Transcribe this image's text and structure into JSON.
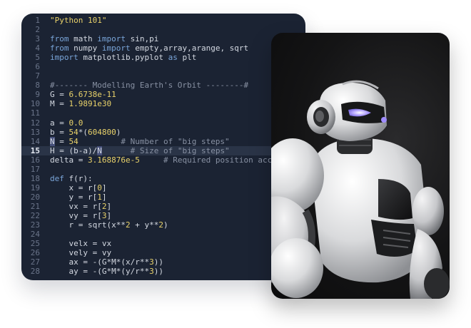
{
  "editor": {
    "active_line": 15,
    "lines": [
      {
        "n": "1",
        "t": [
          {
            "c": "str",
            "s": "\"Python 101\""
          }
        ]
      },
      {
        "n": "2",
        "t": []
      },
      {
        "n": "3",
        "t": [
          {
            "c": "kw",
            "s": "from"
          },
          {
            "c": "",
            "s": " math "
          },
          {
            "c": "kw",
            "s": "import"
          },
          {
            "c": "",
            "s": " sin,pi"
          }
        ]
      },
      {
        "n": "4",
        "t": [
          {
            "c": "kw",
            "s": "from"
          },
          {
            "c": "",
            "s": " numpy "
          },
          {
            "c": "kw",
            "s": "import"
          },
          {
            "c": "",
            "s": " empty,array,arange, sqrt"
          }
        ]
      },
      {
        "n": "5",
        "t": [
          {
            "c": "kw",
            "s": "import"
          },
          {
            "c": "",
            "s": " matplotlib.pyplot "
          },
          {
            "c": "kw",
            "s": "as"
          },
          {
            "c": "",
            "s": " plt"
          }
        ]
      },
      {
        "n": "6",
        "t": []
      },
      {
        "n": "7",
        "t": []
      },
      {
        "n": "8",
        "t": [
          {
            "c": "cmt",
            "s": "#------- Modelling Earth's Orbit --------#"
          }
        ]
      },
      {
        "n": "9",
        "t": [
          {
            "c": "",
            "s": "G = "
          },
          {
            "c": "num",
            "s": "6.6738e-11"
          }
        ]
      },
      {
        "n": "10",
        "t": [
          {
            "c": "",
            "s": "M = "
          },
          {
            "c": "num",
            "s": "1.9891e30"
          }
        ]
      },
      {
        "n": "11",
        "t": []
      },
      {
        "n": "12",
        "t": [
          {
            "c": "",
            "s": "a = "
          },
          {
            "c": "num",
            "s": "0.0"
          }
        ]
      },
      {
        "n": "13",
        "t": [
          {
            "c": "",
            "s": "b = "
          },
          {
            "c": "num",
            "s": "54"
          },
          {
            "c": "",
            "s": "*("
          },
          {
            "c": "num",
            "s": "604800"
          },
          {
            "c": "",
            "s": ")"
          }
        ]
      },
      {
        "n": "14",
        "t": [
          {
            "c": "sel",
            "s": "N"
          },
          {
            "c": "",
            "s": " = "
          },
          {
            "c": "num",
            "s": "54"
          },
          {
            "c": "",
            "s": "         "
          },
          {
            "c": "cmt",
            "s": "# Number of \"big steps\""
          }
        ]
      },
      {
        "n": "15",
        "t": [
          {
            "c": "",
            "s": "H = (b-a)/"
          },
          {
            "c": "sel",
            "s": "N"
          },
          {
            "c": "",
            "s": "      "
          },
          {
            "c": "cmt",
            "s": "# Size of \"big steps\""
          }
        ]
      },
      {
        "n": "16",
        "t": [
          {
            "c": "",
            "s": "delta = "
          },
          {
            "c": "num",
            "s": "3.168876e-5"
          },
          {
            "c": "",
            "s": "     "
          },
          {
            "c": "cmt",
            "s": "# Required position accuracy"
          }
        ]
      },
      {
        "n": "17",
        "t": []
      },
      {
        "n": "18",
        "t": [
          {
            "c": "kw",
            "s": "def"
          },
          {
            "c": "",
            "s": " f(r):"
          }
        ]
      },
      {
        "n": "19",
        "t": [
          {
            "c": "",
            "s": "    x = r["
          },
          {
            "c": "num",
            "s": "0"
          },
          {
            "c": "",
            "s": "]"
          }
        ]
      },
      {
        "n": "20",
        "t": [
          {
            "c": "",
            "s": "    y = r["
          },
          {
            "c": "num",
            "s": "1"
          },
          {
            "c": "",
            "s": "]"
          }
        ]
      },
      {
        "n": "21",
        "t": [
          {
            "c": "",
            "s": "    vx = r["
          },
          {
            "c": "num",
            "s": "2"
          },
          {
            "c": "",
            "s": "]"
          }
        ]
      },
      {
        "n": "22",
        "t": [
          {
            "c": "",
            "s": "    vy = r["
          },
          {
            "c": "num",
            "s": "3"
          },
          {
            "c": "",
            "s": "]"
          }
        ]
      },
      {
        "n": "23",
        "t": [
          {
            "c": "",
            "s": "    r = sqrt(x**"
          },
          {
            "c": "num",
            "s": "2"
          },
          {
            "c": "",
            "s": " + y**"
          },
          {
            "c": "num",
            "s": "2"
          },
          {
            "c": "",
            "s": ")"
          }
        ]
      },
      {
        "n": "24",
        "t": []
      },
      {
        "n": "25",
        "t": [
          {
            "c": "",
            "s": "    velx = vx"
          }
        ]
      },
      {
        "n": "26",
        "t": [
          {
            "c": "",
            "s": "    vely = vy"
          }
        ]
      },
      {
        "n": "27",
        "t": [
          {
            "c": "",
            "s": "    ax = -(G*M*(x/r**"
          },
          {
            "c": "num",
            "s": "3"
          },
          {
            "c": "",
            "s": "))"
          }
        ]
      },
      {
        "n": "28",
        "t": [
          {
            "c": "",
            "s": "    ay = -(G*M*(y/r**"
          },
          {
            "c": "num",
            "s": "3"
          },
          {
            "c": "",
            "s": "))"
          }
        ]
      }
    ]
  },
  "colors": {
    "editor_bg": "#1b2333",
    "keyword": "#7aa6da",
    "string": "#e9d26a",
    "comment": "#8891a3",
    "selection": "#46507a",
    "robot_eye": "#9f8cff"
  },
  "photo": {
    "subject_icon": "robot-photo"
  }
}
